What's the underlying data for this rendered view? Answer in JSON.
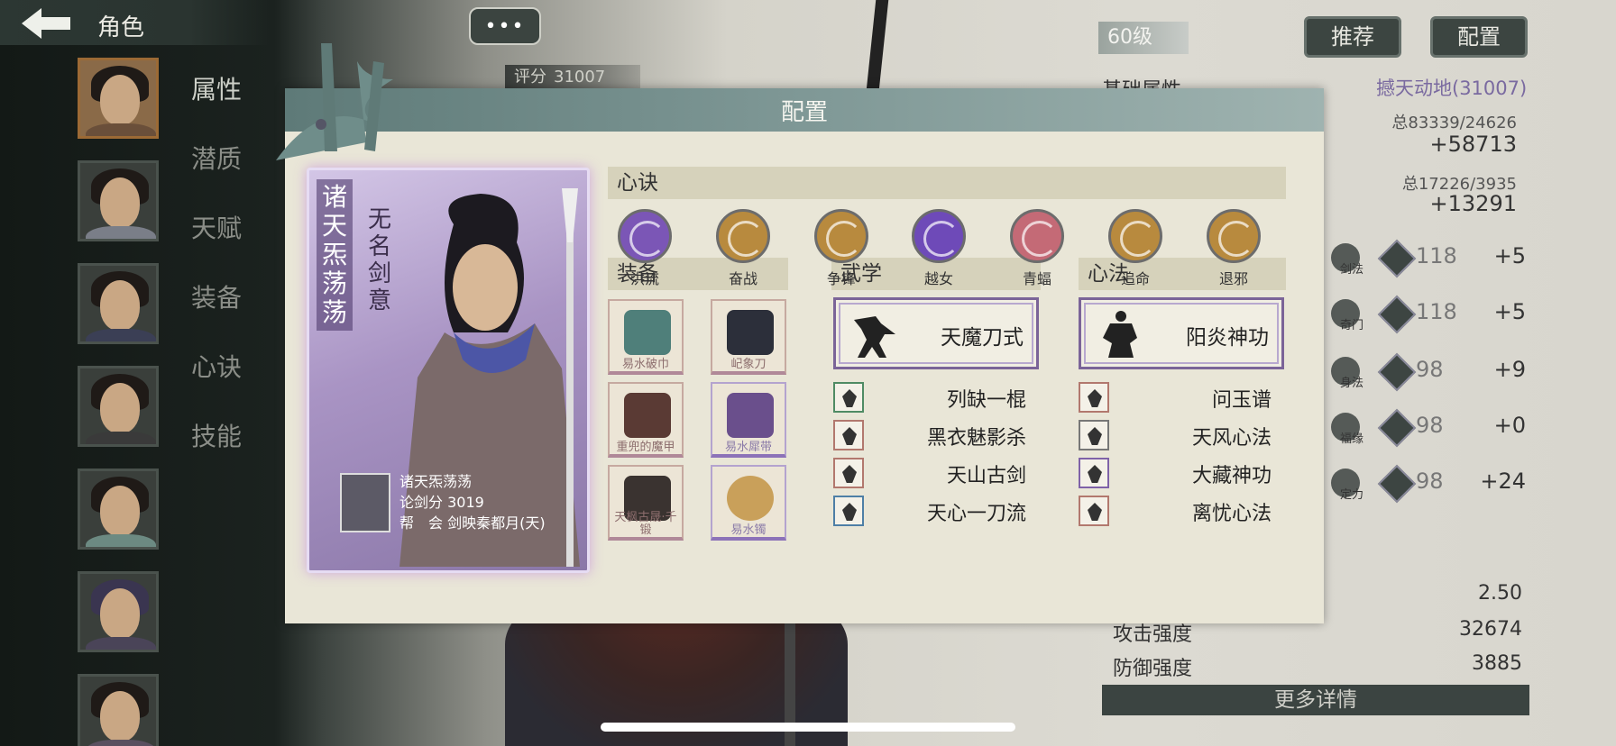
{
  "header": {
    "title": "角色"
  },
  "sidebar": {
    "nav": [
      {
        "label": "属性",
        "active": true
      },
      {
        "label": "潜质"
      },
      {
        "label": "天赋"
      },
      {
        "label": "装备"
      },
      {
        "label": "心诀"
      },
      {
        "label": "技能"
      }
    ]
  },
  "top": {
    "chat": "•••",
    "score_label": "评分",
    "score_value": "31007"
  },
  "stats": {
    "level": "60级",
    "recommend_btn": "推荐",
    "config_btn": "配置",
    "title": "基础属性",
    "rating": "撼天动地(31007)",
    "total1": "总83339/24626",
    "plus1": "+58713",
    "total2": "总17226/3935",
    "plus2": "+13291",
    "skills": [
      {
        "name": "剑法",
        "level": "118",
        "bonus": "+5"
      },
      {
        "name": "奇门",
        "level": "118",
        "bonus": "+5"
      },
      {
        "name": "身法",
        "level": "98",
        "bonus": "+9"
      },
      {
        "name": "福缘",
        "level": "98",
        "bonus": "+0"
      },
      {
        "name": "定力",
        "level": "98",
        "bonus": "+24"
      }
    ],
    "bottom": [
      {
        "label": "",
        "value": "2.50"
      },
      {
        "label": "攻击强度",
        "value": "32674"
      },
      {
        "label": "防御强度",
        "value": "3885"
      }
    ],
    "more_btn": "更多详情"
  },
  "modal": {
    "title": "配置",
    "card": {
      "name_vertical": "诸天炁荡荡",
      "subtitle_vertical": "无名剑意",
      "player_name": "诸天炁荡荡",
      "score_line": "论剑分 3019",
      "guild_line": "帮　会 剑映秦都月(天)"
    },
    "sections": {
      "xinjue": "心诀",
      "equip": "装备",
      "wuxue": "武学",
      "xinfa": "心法"
    },
    "xinjue": [
      {
        "label": "洪流",
        "color": "#7b56b6"
      },
      {
        "label": "奋战",
        "color": "#b88a3e"
      },
      {
        "label": "争锋",
        "color": "#b88a3e"
      },
      {
        "label": "越女",
        "color": "#6e4ab8"
      },
      {
        "label": "青蝠",
        "color": "#c46a76"
      },
      {
        "label": "追命",
        "color": "#b88a3e"
      },
      {
        "label": "退邪",
        "color": "#b88a3e"
      }
    ],
    "equip": [
      {
        "label": "易水破巾",
        "tone": "red",
        "color": "#4f7f7a"
      },
      {
        "label": "屺象刀",
        "tone": "red",
        "color": "#2c2f3a"
      },
      {
        "label": "重兜的魔甲",
        "tone": "red",
        "color": "#5a3a34"
      },
      {
        "label": "易水犀带",
        "tone": "purple",
        "color": "#6a4f8c"
      },
      {
        "label": "天枫古晟·千锻",
        "tone": "red",
        "color": "#3a3330"
      },
      {
        "label": "易水镯",
        "tone": "purple",
        "color": "#c9a05a"
      }
    ],
    "wuxue_main": "天魔刀式",
    "xinfa_main": "阳炎神功",
    "wuxue_list": [
      {
        "label": "列缺一棍",
        "tone": "green"
      },
      {
        "label": "黑衣魅影杀",
        "tone": "red"
      },
      {
        "label": "天山古剑",
        "tone": "red"
      },
      {
        "label": "天心一刀流",
        "tone": "blue"
      }
    ],
    "xinfa_list": [
      {
        "label": "问玉谱",
        "tone": "red"
      },
      {
        "label": "天风心法",
        "tone": "gray"
      },
      {
        "label": "大藏神功",
        "tone": "purple"
      },
      {
        "label": "离忧心法",
        "tone": "red"
      }
    ]
  }
}
